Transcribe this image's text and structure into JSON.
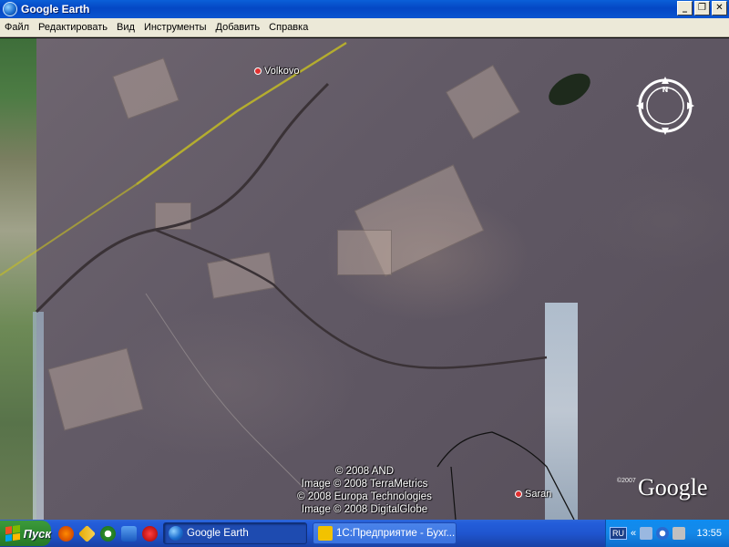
{
  "window": {
    "title": "Google Earth",
    "buttons": [
      "_",
      "❐",
      "✕"
    ]
  },
  "menu": {
    "items": [
      "Файл",
      "Редактировать",
      "Вид",
      "Инструменты",
      "Добавить",
      "Справка"
    ]
  },
  "map": {
    "places": [
      {
        "name": "Volkovo"
      },
      {
        "name": "Saran"
      }
    ],
    "compass_north": "N",
    "credits": [
      "© 2008 AND",
      "Image © 2008 TerraMetrics",
      "© 2008 Europa Technologies",
      "Image © 2008 DigitalGlobe"
    ],
    "watermark_year": "©2007",
    "logo": "Google"
  },
  "taskbar": {
    "start_label": "Пуск",
    "tasks": [
      {
        "label": "Google Earth",
        "active": true
      },
      {
        "label": "1С:Предприятие - Бухг...",
        "active": false
      }
    ],
    "tray": {
      "language": "RU",
      "chevron": "«",
      "clock": "13:55"
    }
  }
}
